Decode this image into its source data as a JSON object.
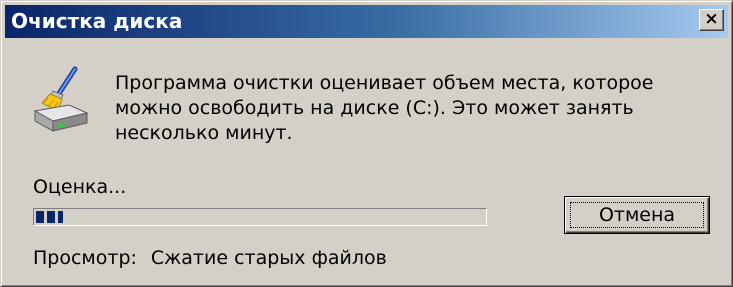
{
  "window": {
    "title": "Очистка диска",
    "close_glyph": "×"
  },
  "icon": {
    "name": "disk-cleanup-icon"
  },
  "message": {
    "text": "Программа очистки оценивает объем места, которое можно освободить на диске  (C:). Это может занять несколько минут."
  },
  "status": {
    "label": "Оценка..."
  },
  "progress": {
    "fraction": 0.06,
    "color": "#0a246a"
  },
  "buttons": {
    "cancel_label": "Отмена"
  },
  "scan": {
    "label": "Просмотр:",
    "value": "Сжатие старых файлов"
  },
  "colors": {
    "face": "#d4d0c8",
    "title_start": "#0a246a",
    "title_end": "#a6caf0"
  }
}
